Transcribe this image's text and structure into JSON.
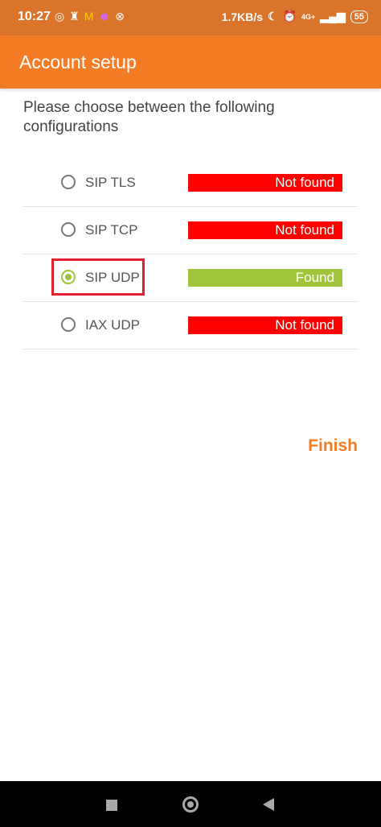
{
  "status_bar": {
    "time": "10:27",
    "left_icons": [
      "whatsapp-icon",
      "app-icon",
      "mcdonalds-icon",
      "cat-icon",
      "close-circle-icon"
    ],
    "speed": "1.7KB/s",
    "network": "4G+",
    "battery": "55"
  },
  "app_bar": {
    "title": "Account setup",
    "color": "#f47c25"
  },
  "prompt": "Please choose between the following configurations",
  "configurations": [
    {
      "label": "SIP TLS",
      "status": "Not found",
      "checked": false
    },
    {
      "label": "SIP TCP",
      "status": "Not found",
      "checked": false
    },
    {
      "label": "SIP UDP",
      "status": "Found",
      "checked": true
    },
    {
      "label": "IAX UDP",
      "status": "Not found",
      "checked": false
    }
  ],
  "finish_label": "Finish",
  "colors": {
    "not_found": "#ff0000",
    "found": "#a0c43c",
    "highlight": "#e0202a"
  }
}
